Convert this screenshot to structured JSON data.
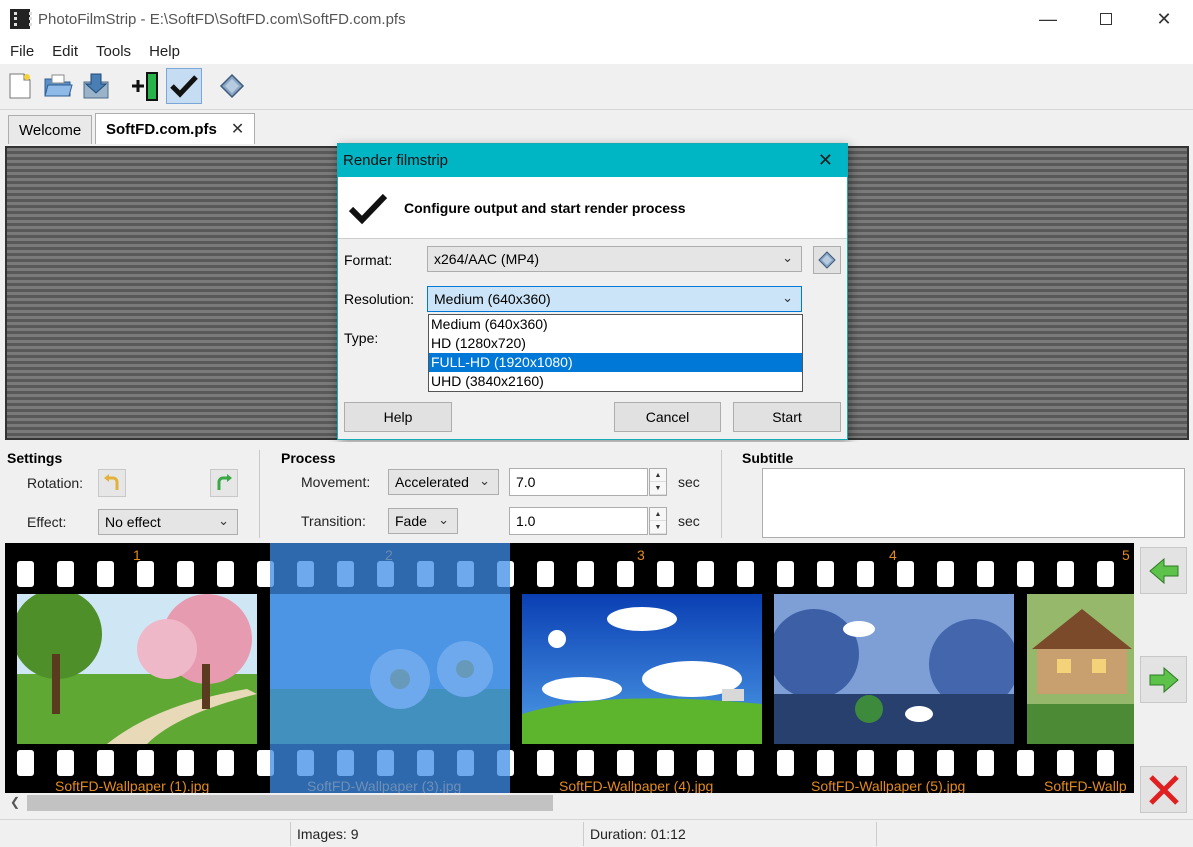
{
  "window": {
    "title": "PhotoFilmStrip - E:\\SoftFD\\SoftFD.com\\SoftFD.com.pfs"
  },
  "menu": [
    "File",
    "Edit",
    "Tools",
    "Help"
  ],
  "toolbar": {
    "icons": [
      "new-project-icon",
      "open-folder-icon",
      "save-icon",
      "import-pictures-icon",
      "render-checkmark-icon",
      "diamond-icon"
    ]
  },
  "tabs": [
    {
      "label": "Welcome"
    },
    {
      "label": "SoftFD.com.pfs",
      "close": "✕"
    }
  ],
  "dialog": {
    "title": "Render filmstrip",
    "header": "Configure output and start render process",
    "format_label": "Format:",
    "format_value": "x264/AAC (MP4)",
    "resolution_label": "Resolution:",
    "resolution_value": "Medium (640x360)",
    "type_label": "Type:",
    "resolution_options": [
      "Medium (640x360)",
      "HD (1280x720)",
      "FULL-HD (1920x1080)",
      "UHD (3840x2160)"
    ],
    "highlighted_option": "FULL-HD (1920x1080)",
    "buttons": {
      "help": "Help",
      "cancel": "Cancel",
      "start": "Start"
    }
  },
  "settings": {
    "title": "Settings",
    "rotation_label": "Rotation:",
    "effect_label": "Effect:",
    "effect_value": "No effect"
  },
  "process": {
    "title": "Process",
    "movement_label": "Movement:",
    "movement_value": "Accelerated",
    "movement_seconds": "7.0",
    "transition_label": "Transition:",
    "transition_value": "Fade",
    "transition_seconds": "1.0",
    "sec_label": "sec"
  },
  "subtitle": {
    "title": "Subtitle"
  },
  "filmstrip": {
    "frames": [
      {
        "number": "1",
        "label": "SoftFD-Wallpaper (1).jpg"
      },
      {
        "number": "2",
        "label": "SoftFD-Wallpaper (3).jpg"
      },
      {
        "number": "3",
        "label": "SoftFD-Wallpaper (4).jpg"
      },
      {
        "number": "4",
        "label": "SoftFD-Wallpaper (5).jpg"
      },
      {
        "number": "5",
        "label": "SoftFD-Wallp"
      }
    ]
  },
  "status": {
    "images": "Images: 9",
    "duration": "Duration: 01:12"
  },
  "colors": {
    "dialog_titlebar": "#00b6c5",
    "selection": "#0078d7",
    "film_text": "#e58b1c"
  }
}
